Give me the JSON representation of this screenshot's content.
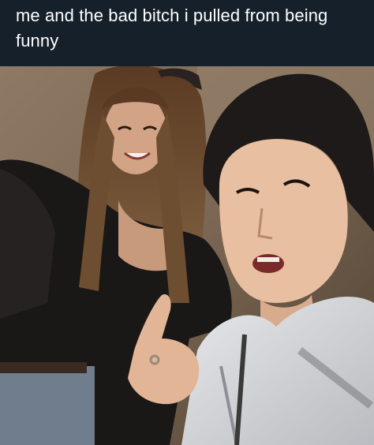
{
  "caption": {
    "text": "me and the bad bitch i pulled from being funny"
  },
  "photo": {
    "description_icon": "selfie-photo",
    "colors": {
      "caption_background": "#15202b",
      "caption_text": "#ffffff"
    }
  }
}
